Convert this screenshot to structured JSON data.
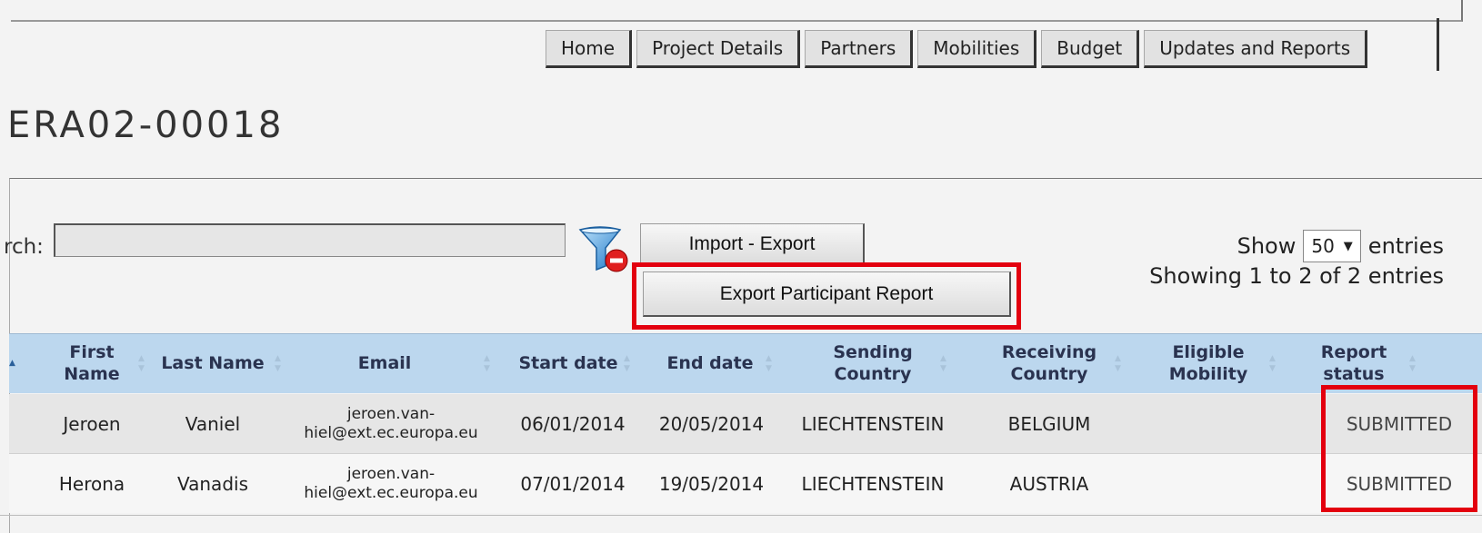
{
  "nav": {
    "tabs": [
      {
        "label": "Home"
      },
      {
        "label": "Project Details"
      },
      {
        "label": "Partners"
      },
      {
        "label": "Mobilities"
      },
      {
        "label": "Budget"
      },
      {
        "label": "Updates and Reports"
      }
    ]
  },
  "page": {
    "title": "ERA02-00018"
  },
  "search": {
    "label": "rch:",
    "value": "",
    "filter_icon": "filter-clear-icon"
  },
  "buttons": {
    "import_export": "Import - Export",
    "export_report": "Export Participant Report"
  },
  "length": {
    "show": "Show",
    "value": "50",
    "entries": "entries"
  },
  "info": "Showing 1 to 2 of 2 entries",
  "table": {
    "headers": [
      "First Name",
      "Last Name",
      "Email",
      "Start date",
      "End date",
      "Sending Country",
      "Receiving Country",
      "Eligible Mobility",
      "Report status"
    ],
    "rows": [
      {
        "first": "Jeroen",
        "last": "Vaniel",
        "email": "jeroen.van-hiel@ext.ec.europa.eu",
        "start": "06/01/2014",
        "end": "20/05/2014",
        "sending": "LIECHTENSTEIN",
        "receiving": "BELGIUM",
        "eligible": "",
        "status": "SUBMITTED"
      },
      {
        "first": "Herona",
        "last": "Vanadis",
        "email": "jeroen.van-hiel@ext.ec.europa.eu",
        "start": "07/01/2014",
        "end": "19/05/2014",
        "sending": "LIECHTENSTEIN",
        "receiving": "AUSTRIA",
        "eligible": "",
        "status": "SUBMITTED"
      }
    ]
  },
  "colors": {
    "highlight": "#e3000f",
    "header_bg": "#bcd7ee",
    "row_odd": "#e6e6e6",
    "row_even": "#f6f6f6"
  }
}
